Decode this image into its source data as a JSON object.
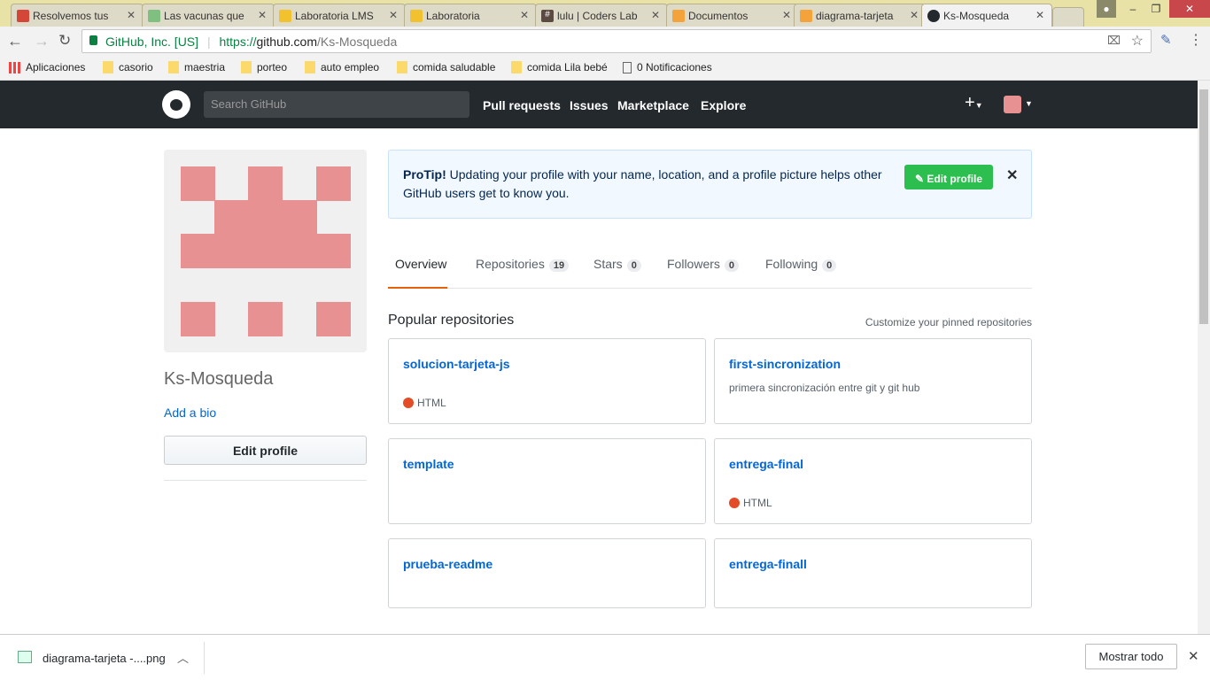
{
  "browser": {
    "tabs": [
      {
        "title": "Resolvemos tus",
        "color": "#d44638"
      },
      {
        "title": "Las vacunas que",
        "color": "#7fbf7f"
      },
      {
        "title": "Laboratoria LMS",
        "color": "#f2c12e"
      },
      {
        "title": "Laboratoria",
        "color": "#f2c12e"
      },
      {
        "title": "lulu | Coders Lab",
        "color": "#5b4a42"
      },
      {
        "title": "Documentos",
        "color": "#f4a23a"
      },
      {
        "title": "diagrama-tarjeta",
        "color": "#f4a23a"
      },
      {
        "title": "Ks-Mosqueda",
        "color": "#24292e"
      }
    ],
    "security_label": "GitHub, Inc. [US]",
    "url_prefix": "https://",
    "url_domain": "github.com",
    "url_path": "/Ks-Mosqueda",
    "bookmarks": [
      "Aplicaciones",
      "casorio",
      "maestria",
      "porteo",
      "auto empleo",
      "comida saludable",
      "comida Lila bebé",
      "0 Notificaciones"
    ]
  },
  "github": {
    "search_placeholder": "Search GitHub",
    "nav": [
      "Pull requests",
      "Issues",
      "Marketplace",
      "Explore"
    ],
    "username": "Ks-Mosqueda",
    "add_bio": "Add a bio",
    "edit_profile": "Edit profile",
    "protip_title": "ProTip!",
    "protip_text": " Updating your profile with your name, location, and a profile picture helps other GitHub users get to know you.",
    "protip_button": "Edit profile",
    "tabs": [
      {
        "label": "Overview"
      },
      {
        "label": "Repositories",
        "count": "19"
      },
      {
        "label": "Stars",
        "count": "0"
      },
      {
        "label": "Followers",
        "count": "0"
      },
      {
        "label": "Following",
        "count": "0"
      }
    ],
    "popular_title": "Popular repositories",
    "customize_link": "Customize your pinned repositories",
    "repos": [
      {
        "name": "solucion-tarjeta-js",
        "desc": "",
        "lang": "HTML"
      },
      {
        "name": "first-sincronization",
        "desc": "primera sincronización entre git y git hub",
        "lang": ""
      },
      {
        "name": "template",
        "desc": "",
        "lang": ""
      },
      {
        "name": "entrega-final",
        "desc": "",
        "lang": "HTML"
      },
      {
        "name": "prueba-readme",
        "desc": "",
        "lang": ""
      },
      {
        "name": "entrega-finall",
        "desc": "",
        "lang": ""
      }
    ],
    "lang_color": "#e34c26"
  },
  "downloads": {
    "file": "diagrama-tarjeta -....png",
    "show_all": "Mostrar todo"
  }
}
